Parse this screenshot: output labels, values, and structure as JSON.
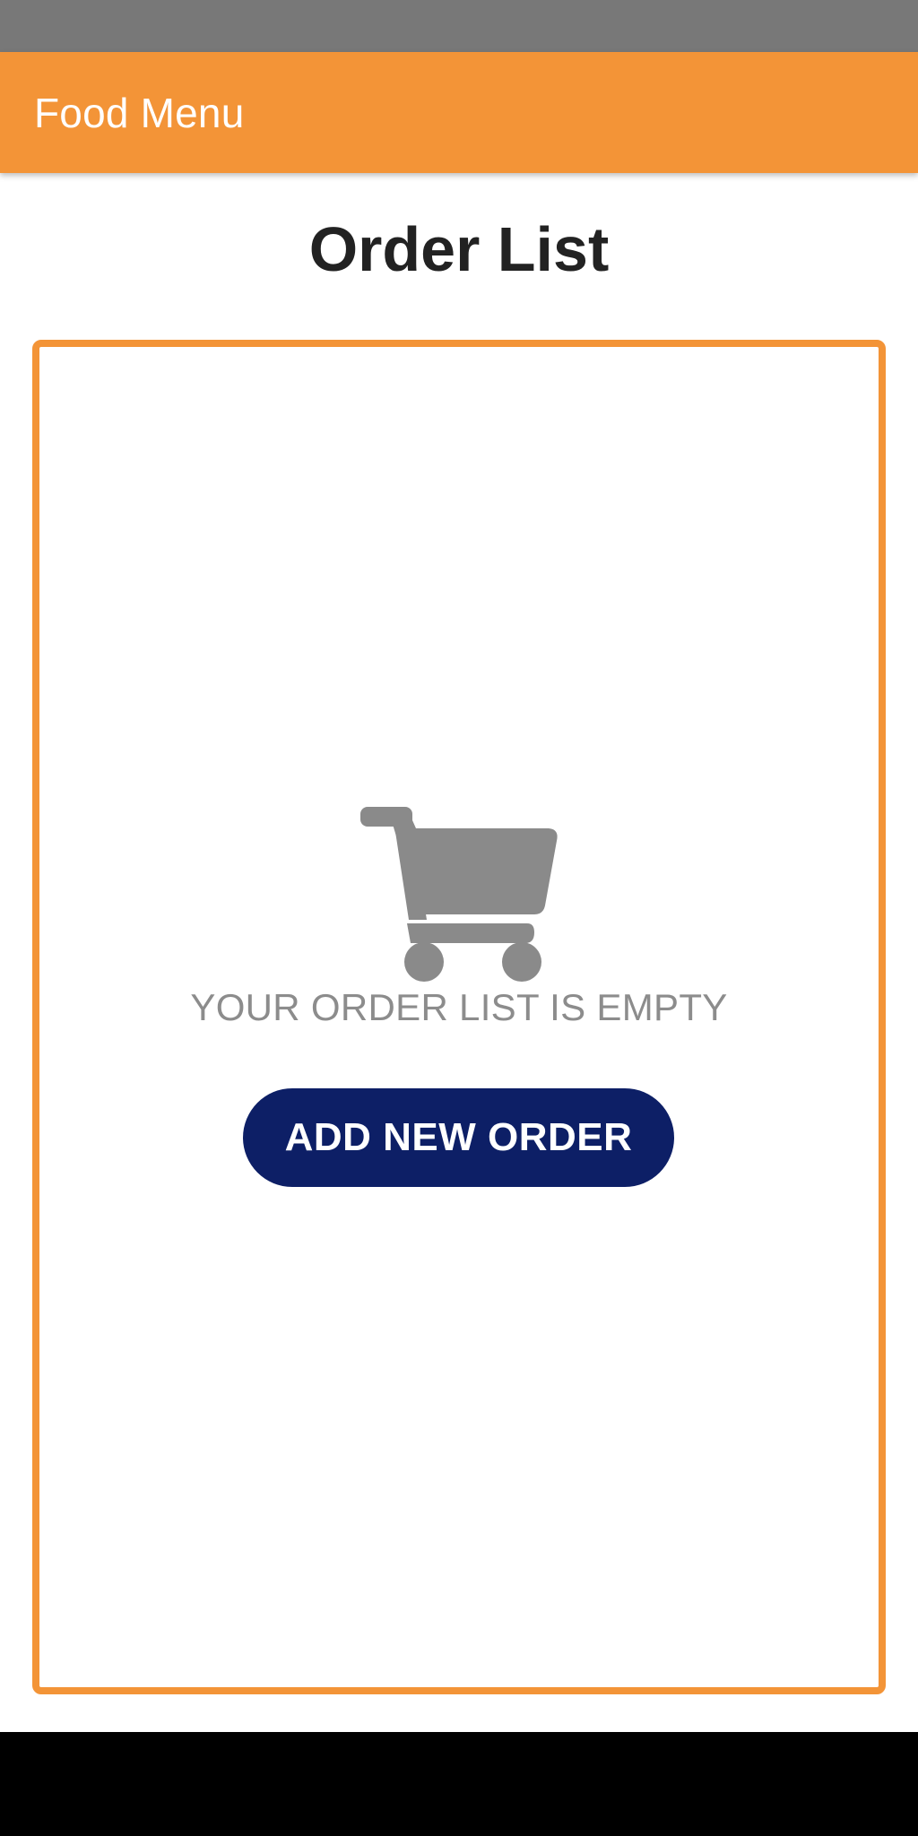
{
  "app_bar": {
    "title": "Food Menu"
  },
  "page": {
    "title": "Order List"
  },
  "empty_state": {
    "icon": "shopping-cart-icon",
    "message": "YOUR ORDER LIST IS EMPTY"
  },
  "actions": {
    "add_order_label": "ADD NEW ORDER"
  },
  "colors": {
    "status_bar": "#787878",
    "primary": "#f39437",
    "button": "#0d1f66",
    "icon": "#8a8a8a",
    "muted_text": "#8c8c8c",
    "title_text": "#222222"
  }
}
